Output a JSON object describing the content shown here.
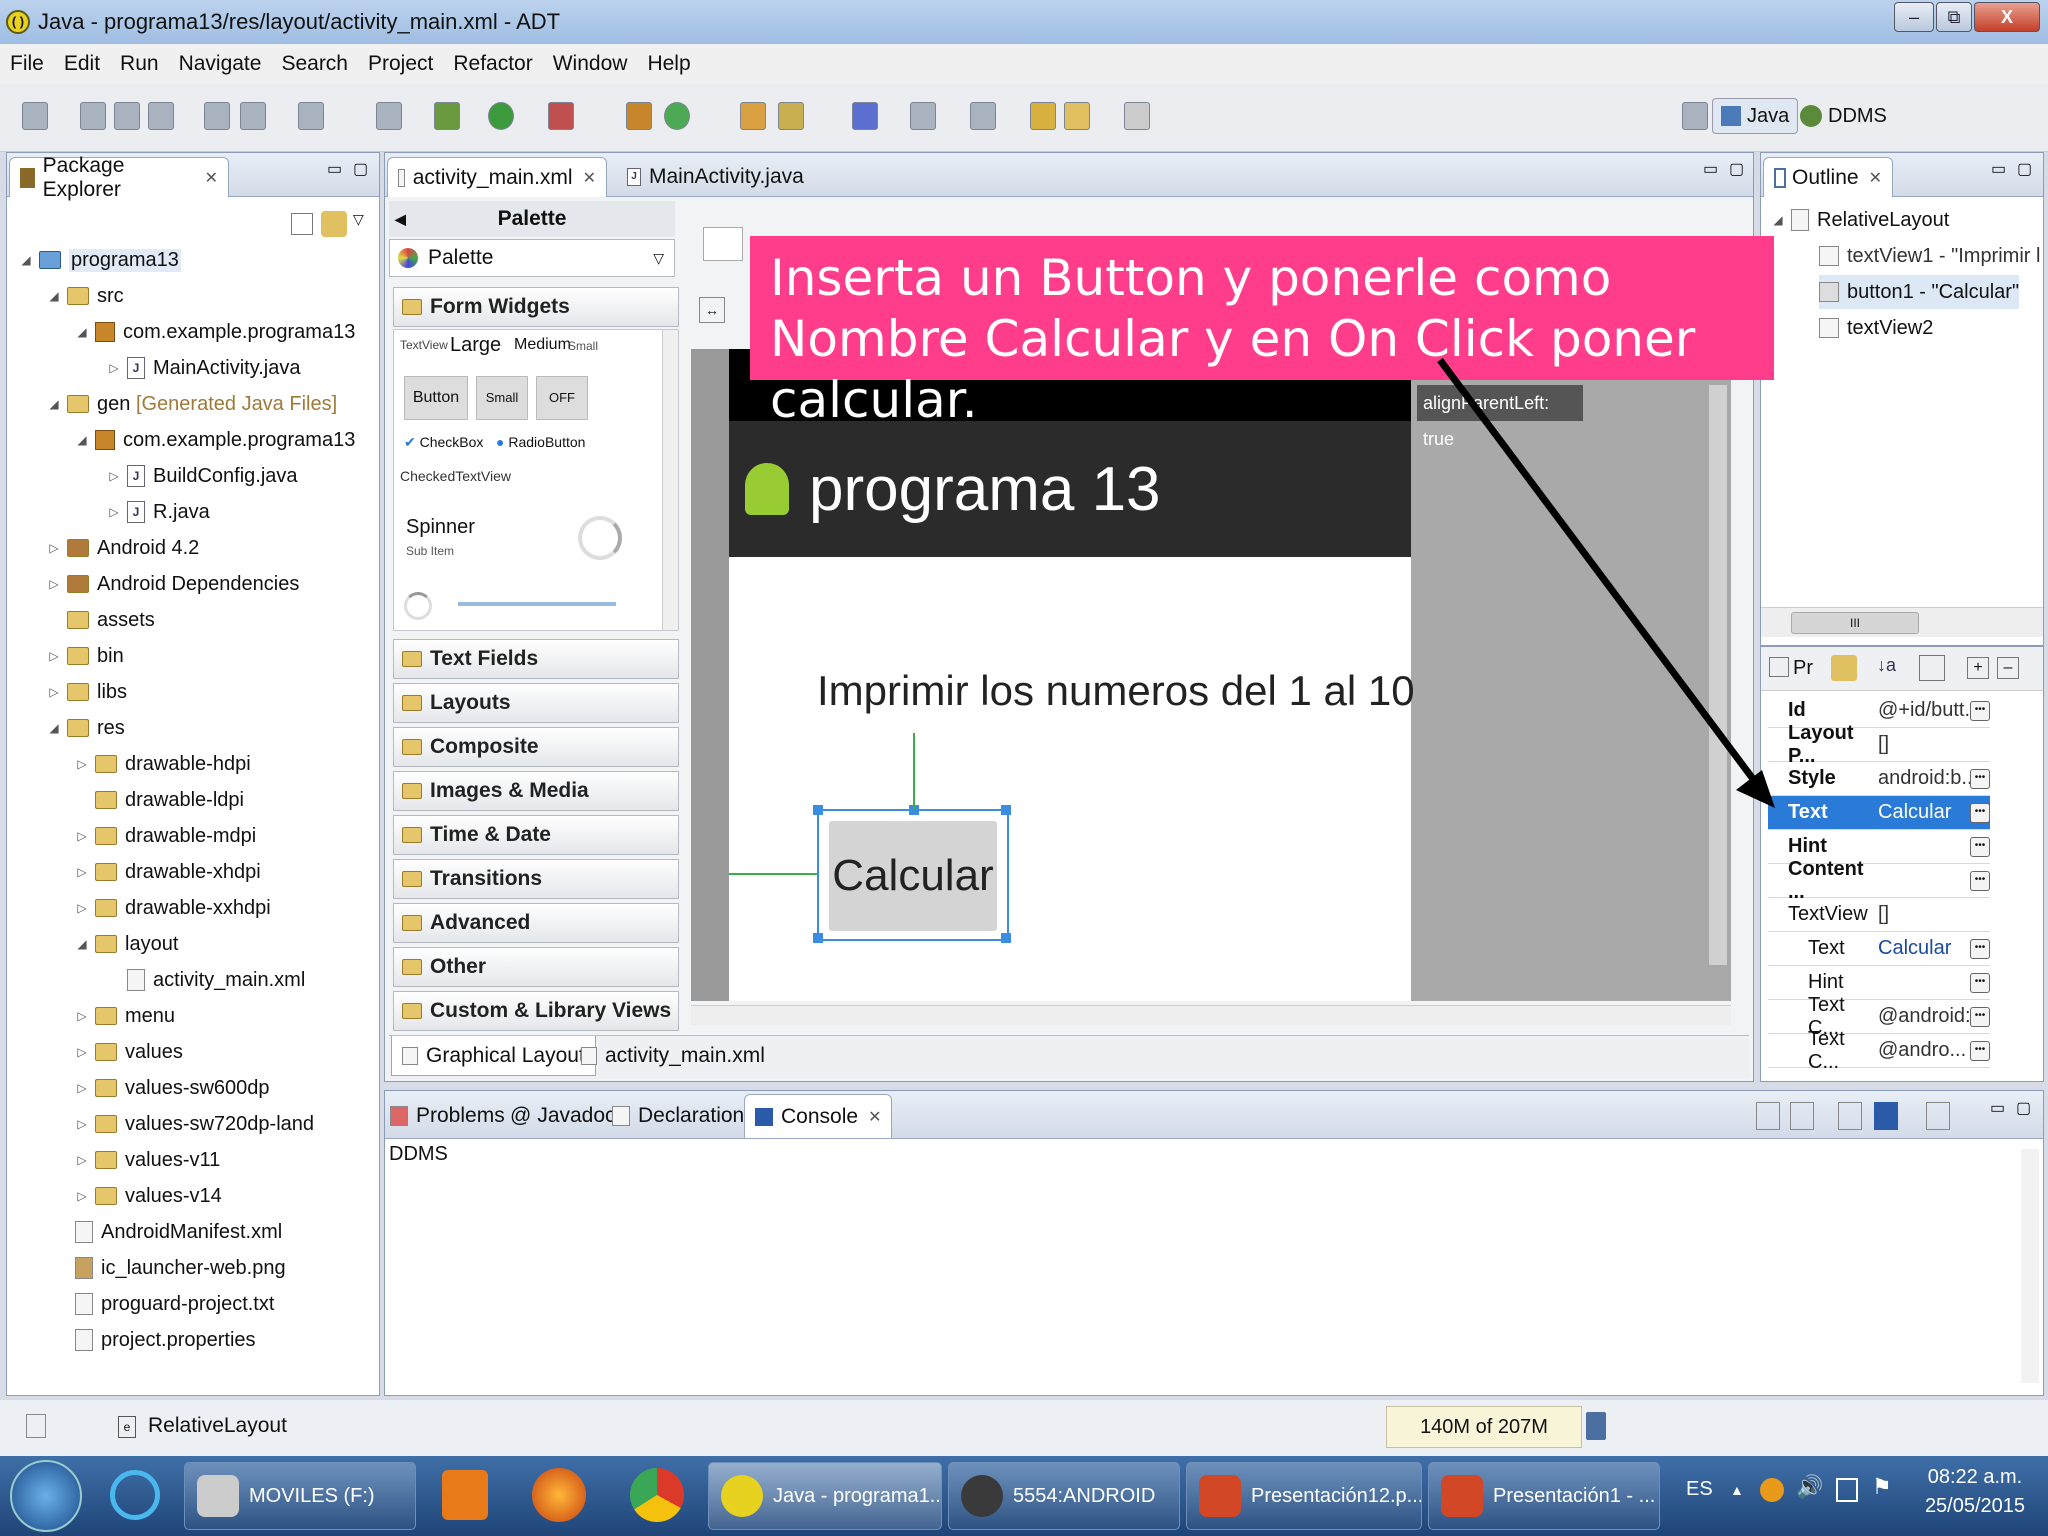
{
  "window": {
    "title": "Java - programa13/res/layout/activity_main.xml - ADT",
    "min": "–",
    "max": "⧉",
    "close": "X"
  },
  "menu": [
    "File",
    "Edit",
    "Run",
    "Navigate",
    "Search",
    "Project",
    "Refactor",
    "Window",
    "Help"
  ],
  "perspectives": {
    "java": "Java",
    "ddms": "DDMS"
  },
  "package_explorer": {
    "title": "Package Explorer",
    "items": [
      {
        "label": "programa13"
      },
      {
        "label": "src"
      },
      {
        "label": "com.example.programa13"
      },
      {
        "label": "MainActivity.java"
      },
      {
        "label": "gen",
        "extra": "[Generated Java Files]"
      },
      {
        "label": "com.example.programa13"
      },
      {
        "label": "BuildConfig.java"
      },
      {
        "label": "R.java"
      },
      {
        "label": "Android 4.2"
      },
      {
        "label": "Android Dependencies"
      },
      {
        "label": "assets"
      },
      {
        "label": "bin"
      },
      {
        "label": "libs"
      },
      {
        "label": "res"
      },
      {
        "label": "drawable-hdpi"
      },
      {
        "label": "drawable-ldpi"
      },
      {
        "label": "drawable-mdpi"
      },
      {
        "label": "drawable-xhdpi"
      },
      {
        "label": "drawable-xxhdpi"
      },
      {
        "label": "layout"
      },
      {
        "label": "activity_main.xml"
      },
      {
        "label": "menu"
      },
      {
        "label": "values"
      },
      {
        "label": "values-sw600dp"
      },
      {
        "label": "values-sw720dp-land"
      },
      {
        "label": "values-v11"
      },
      {
        "label": "values-v14"
      },
      {
        "label": "AndroidManifest.xml"
      },
      {
        "label": "ic_launcher-web.png"
      },
      {
        "label": "proguard-project.txt"
      },
      {
        "label": "project.properties"
      }
    ]
  },
  "editor": {
    "tabs": [
      "activity_main.xml",
      "MainActivity.java"
    ],
    "palette_header": "Palette",
    "palette_dropdown": "Palette",
    "form_widgets": "Form Widgets",
    "widgets": {
      "textview": "TextView",
      "large": "Large",
      "medium": "Medium",
      "small": "Small",
      "button": "Button",
      "small_btn": "Small",
      "off": "OFF",
      "checkbox": "CheckBox",
      "radio": "RadioButton",
      "checked_tv": "CheckedTextView",
      "spinner": "Spinner",
      "sub_item": "Sub Item"
    },
    "categories": [
      "Text Fields",
      "Layouts",
      "Composite",
      "Images & Media",
      "Time & Date",
      "Transitions",
      "Advanced",
      "Other",
      "Custom & Library Views"
    ],
    "canvas": {
      "app_title": "programa 13",
      "text": "Imprimir los numeros del 1 al 10",
      "button": "Calcular",
      "hint": "alignParentLeft: true"
    },
    "bottom_tabs": [
      "Graphical Layout",
      "activity_main.xml"
    ]
  },
  "outline": {
    "title": "Outline",
    "root": "RelativeLayout",
    "children": [
      "textView1 - \"Imprimir l",
      "button1 - \"Calcular\"",
      "textView2"
    ],
    "scroll": "III"
  },
  "properties": {
    "rows": [
      {
        "k": "Id",
        "v": "@+id/butt..."
      },
      {
        "k": "Layout P...",
        "v": "[]"
      },
      {
        "k": "Style",
        "v": "android:b..."
      },
      {
        "k": "Text",
        "v": "Calcular",
        "selected": true
      },
      {
        "k": "Hint",
        "v": ""
      },
      {
        "k": "Content ...",
        "v": ""
      },
      {
        "k": "TextView",
        "v": "[]"
      },
      {
        "k": "Text",
        "v": "Calcular"
      },
      {
        "k": "Hint",
        "v": ""
      },
      {
        "k": "Text C...",
        "v": "@android:..."
      },
      {
        "k": "Text C...",
        "v": "@andro..."
      }
    ],
    "header": "Pr"
  },
  "bottom_panel": {
    "tabs": [
      "Problems",
      "Javadoc",
      "Declaration",
      "Console"
    ],
    "console_label": "DDMS"
  },
  "status": {
    "selection": "RelativeLayout",
    "memory": "140M of 207M"
  },
  "annotation": {
    "text": "Inserta un Button y ponerle como Nombre Calcular y en On Click poner calcular.",
    "color": "#ff3d8b"
  },
  "taskbar": {
    "items": [
      "MOVILES (F:)",
      "Java - programa1...",
      "5554:ANDROID",
      "Presentación12.p...",
      "Presentación1 - ..."
    ],
    "lang": "ES",
    "time": "08:22 a.m.",
    "date": "25/05/2015"
  }
}
